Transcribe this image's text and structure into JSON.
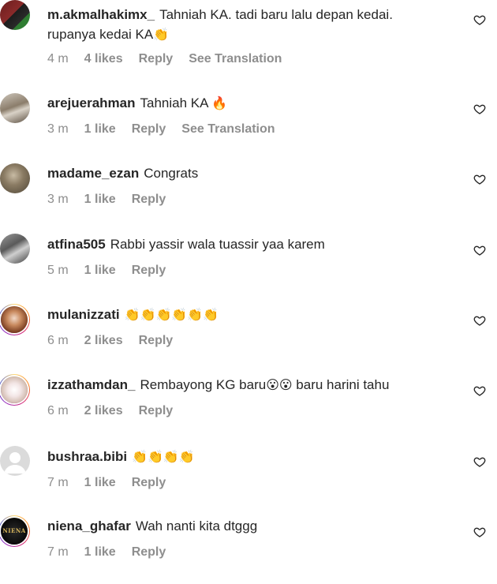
{
  "comments": [
    {
      "username": "m.akmalhakimx_",
      "text_line1": "Tahniah KA. tadi baru lalu depan kedai.",
      "text_line2": "rupanya kedai KA",
      "emoji": "👏",
      "time": "4 m",
      "likes": "4 likes",
      "reply": "Reply",
      "translation": "See Translation"
    },
    {
      "username": "arejuerahman",
      "text": "Tahniah KA",
      "emoji": "🔥",
      "time": "3 m",
      "likes": "1 like",
      "reply": "Reply",
      "translation": "See Translation"
    },
    {
      "username": "madame_ezan",
      "text": "Congrats",
      "time": "3 m",
      "likes": "1 like",
      "reply": "Reply"
    },
    {
      "username": "atfina505",
      "text": "Rabbi yassir wala tuassir yaa karem",
      "time": "5 m",
      "likes": "1 like",
      "reply": "Reply"
    },
    {
      "username": "mulanizzati",
      "emoji": "👏👏👏👏👏👏",
      "time": "6 m",
      "likes": "2 likes",
      "reply": "Reply"
    },
    {
      "username": "izzathamdan_",
      "text": "Rembayong KG baru",
      "emoji": "😮😮",
      "text_after": "baru harini tahu",
      "time": "6 m",
      "likes": "2 likes",
      "reply": "Reply"
    },
    {
      "username": "bushraa.bibi",
      "emoji": "👏👏👏👏",
      "time": "7 m",
      "likes": "1 like",
      "reply": "Reply"
    },
    {
      "username": "niena_ghafar",
      "text": "Wah nanti kita dtggg",
      "time": "7 m",
      "likes": "1 like",
      "reply": "Reply",
      "avatar_logo": "NIENA"
    }
  ],
  "icons": {
    "like": "heart-outline-icon",
    "default_avatar": "default-user-icon"
  },
  "colors": {
    "text": "#262626",
    "meta": "#8e8e8e",
    "story_ring": "#d62976"
  }
}
